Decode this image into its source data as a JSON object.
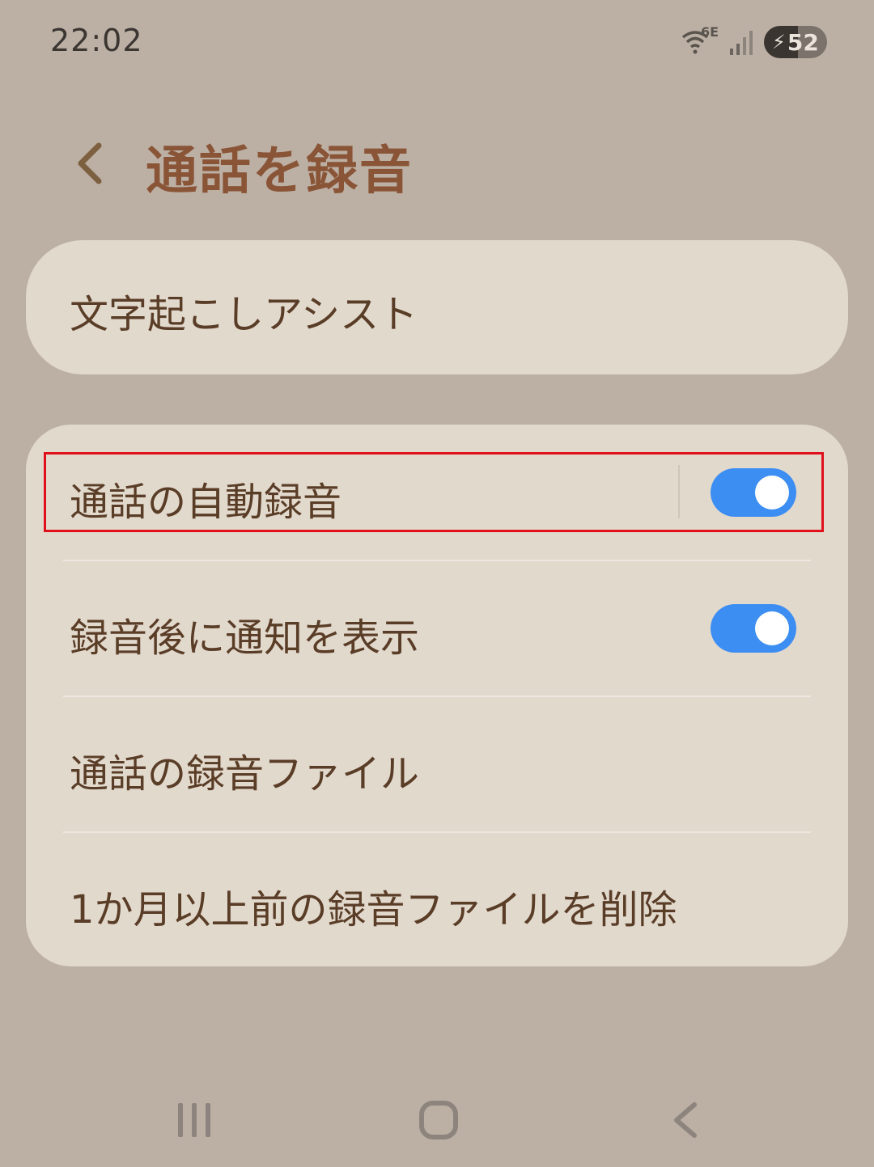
{
  "status_bar": {
    "time": "22:02",
    "wifi_tag": "6E",
    "battery_level": "52",
    "icons": [
      "wifi-icon",
      "signal-icon",
      "battery-charging-icon"
    ]
  },
  "header": {
    "title": "通話を録音",
    "back_icon": "chevron-left-icon"
  },
  "cards": {
    "transcription": {
      "label": "文字起こしアシスト"
    },
    "settings": {
      "items": [
        {
          "label": "通話の自動録音",
          "toggle": true
        },
        {
          "label": "録音後に通知を表示",
          "toggle": true
        },
        {
          "label": "通話の録音ファイル"
        },
        {
          "label": "1か月以上前の録音ファイルを削除"
        }
      ]
    }
  },
  "colors": {
    "background": "#bcb0a5",
    "card": "#e2d9cd",
    "title": "#8a5537",
    "text": "#5a3d27",
    "toggle_on": "#3d8ef2",
    "highlight": "#e0101c"
  },
  "nav_bar": {
    "icons": [
      "recents-icon",
      "home-icon",
      "back-icon"
    ]
  }
}
